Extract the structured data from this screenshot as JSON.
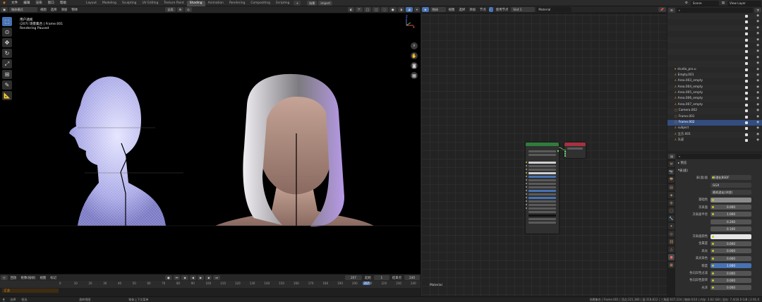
{
  "topbar": {
    "menus": [
      "文件",
      "编辑",
      "渲染",
      "窗口",
      "帮助"
    ],
    "workspaces": [
      "Layout",
      "Modeling",
      "Sculpting",
      "UV Editing",
      "Texture Paint",
      "Shading",
      "Animation",
      "Rendering",
      "Compositing",
      "Scripting"
    ],
    "active_workspace": "Shading",
    "pill_left": "场景",
    "pill_right": "import",
    "scene": "Scene",
    "view_layer": "View Layer"
  },
  "viewport": {
    "mode": "物体模式",
    "menus": [
      "视图",
      "选择",
      "添加",
      "物体"
    ],
    "orientation": "全局",
    "overlay": {
      "view_name": "用户透视",
      "frame_info": "(207) 场景集合 | Frame.001",
      "render_status": "Rendering Paused"
    },
    "axis_z": "Z",
    "axis_x": "X"
  },
  "timeline": {
    "menus": [
      "回放",
      "抠像(插帧)",
      "视图",
      "标记"
    ],
    "current_frame": "207",
    "start_label": "起始",
    "start": "1",
    "end_label": "结束点",
    "end": "240",
    "ticks": [
      "0",
      "10",
      "20",
      "30",
      "40",
      "50",
      "60",
      "70",
      "80",
      "90",
      "100",
      "110",
      "120",
      "130",
      "140",
      "150",
      "160",
      "170",
      "180",
      "190",
      "200",
      "207",
      "210",
      "220",
      "230",
      "240"
    ],
    "track_label": "汇总"
  },
  "node_editor": {
    "menus": [
      "物体",
      "视图",
      "选择",
      "添加",
      "节点"
    ],
    "use_nodes": "使用节点",
    "slot": "Slot 1",
    "material": "Material",
    "bottom_label": "Material"
  },
  "outliner": {
    "rows": [
      {
        "label": "",
        "icon": "",
        "sel": false
      },
      {
        "label": "",
        "icon": "",
        "sel": false
      },
      {
        "label": "",
        "icon": "",
        "sel": false
      },
      {
        "label": "",
        "icon": "",
        "sel": false
      },
      {
        "label": "",
        "icon": "",
        "sel": false
      },
      {
        "label": "",
        "icon": "",
        "sel": false
      },
      {
        "label": "",
        "icon": "",
        "sel": false
      },
      {
        "label": "",
        "icon": "",
        "sel": false
      },
      {
        "label": "",
        "icon": "",
        "sel": false
      },
      {
        "label": "studio_pro.u",
        "icon": "▾",
        "sel": false
      },
      {
        "label": "Empty.001",
        "icon": "⅄",
        "sel": false
      },
      {
        "label": "Area.003_empty",
        "icon": "⅄",
        "sel": false
      },
      {
        "label": "Area.004_empty",
        "icon": "⅄",
        "sel": false
      },
      {
        "label": "Area.005_empty",
        "icon": "⅄",
        "sel": false
      },
      {
        "label": "Area.006_empty",
        "icon": "⅄",
        "sel": false
      },
      {
        "label": "Area.007_empty",
        "icon": "⅄",
        "sel": false
      },
      {
        "label": "Camera.002",
        "icon": "◻",
        "sel": false
      },
      {
        "label": "Frame.001",
        "icon": "◻",
        "sel": false
      },
      {
        "label": "Frame.002",
        "icon": "◻",
        "sel": true
      },
      {
        "label": "subject",
        "icon": "⅄",
        "sel": false
      },
      {
        "label": "立方.001",
        "icon": "⅄",
        "sel": false
      },
      {
        "label": "头皮",
        "icon": "⅄",
        "sel": false
      }
    ]
  },
  "properties": {
    "section": "表(面)",
    "rows": [
      {
        "label": "表(面)面",
        "value": "原理化BSDF",
        "kind": "dark"
      },
      {
        "label": "",
        "value": "GGX",
        "kind": "dark"
      },
      {
        "label": "",
        "value": "随机游走(浏览)",
        "kind": "dark"
      },
      {
        "label": "基础色",
        "value": "",
        "kind": "color"
      },
      {
        "label": "次表面",
        "value": "0.000",
        "kind": "plain"
      },
      {
        "label": "次表面半径",
        "value": "1.000",
        "kind": "plain"
      },
      {
        "label": "",
        "value": "0.200",
        "kind": "plain"
      },
      {
        "label": "",
        "value": "0.100",
        "kind": "plain"
      },
      {
        "label": "次表面颜色",
        "value": "",
        "kind": "white"
      },
      {
        "label": "金属度",
        "value": "0.000",
        "kind": "plain"
      },
      {
        "label": "高光",
        "value": "0.000",
        "kind": "plain"
      },
      {
        "label": "高光染色",
        "value": "0.000",
        "kind": "plain"
      },
      {
        "label": "糙度",
        "value": "1.000",
        "kind": "blue"
      },
      {
        "label": "各向异性过滤",
        "value": "0.000",
        "kind": "plain"
      },
      {
        "label": "各向异性旋转",
        "value": "0.000",
        "kind": "plain"
      },
      {
        "label": "光泽",
        "value": "0.000",
        "kind": "plain"
      }
    ]
  },
  "statusbar": {
    "left": [
      "选择",
      "框选",
      "旋转视图",
      "物体上下文菜单"
    ],
    "right": "场景集合 | Frame.001 | 顶点:321,360 | 面:318,612 | 三角面:637,224 | 物体:0/10 | 内存: 3.62 GiB | 显存: 7.4/16.0 GiB | 2.91.0"
  },
  "colors": {
    "accent": "#4772b3",
    "orange": "#e59933",
    "viewport_bg": "#000000"
  }
}
